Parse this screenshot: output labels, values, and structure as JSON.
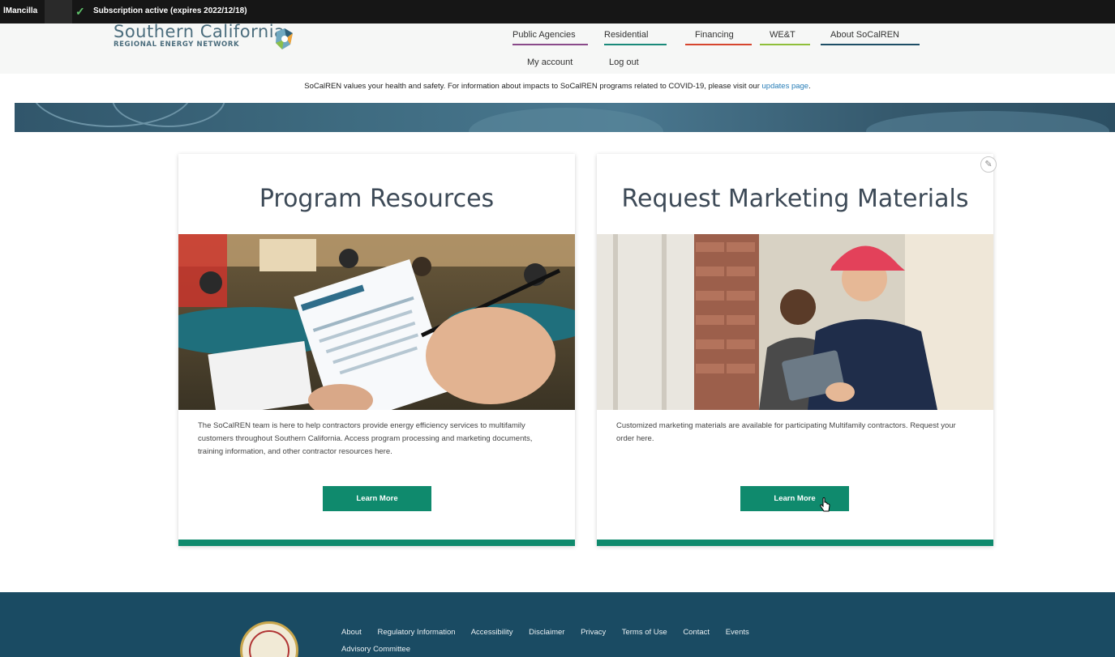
{
  "admin_bar": {
    "user": "lMancilla",
    "status": "Subscription active (expires 2022/12/18)",
    "check_color": "#5fc36a"
  },
  "header": {
    "logo_line1": "Southern California",
    "logo_line2": "REGIONAL ENERGY NETWORK",
    "nav": [
      {
        "label": "Public Agencies",
        "color": "#8a4a8a"
      },
      {
        "label": "Residential",
        "color": "#1a8a7a"
      },
      {
        "label": "Financing",
        "color": "#d6452e"
      },
      {
        "label": "WE&T",
        "color": "#8fbf3a"
      },
      {
        "label": "About SoCalREN",
        "color": "#1e4e66"
      }
    ],
    "sub_nav": [
      "My account",
      "Log out"
    ]
  },
  "notice": {
    "text": "SoCalREN values your health and safety. For information about impacts to SoCalREN programs related to COVID-19, please visit our ",
    "link": "updates page",
    "end": "."
  },
  "cards": [
    {
      "title": "Program Resources",
      "description": "The SoCalREN team is here to help contractors provide energy efficiency services to multifamily customers throughout Southern California. Access program processing and marketing documents, training information, and other contractor resources here.",
      "button": "Learn More"
    },
    {
      "title": "Request Marketing Materials",
      "description": "Customized marketing materials are available for participating Multifamily contractors. Request your order here.",
      "button": "Learn More"
    }
  ],
  "footer": {
    "links": [
      "About",
      "Regulatory Information",
      "Accessibility",
      "Disclaimer",
      "Privacy",
      "Terms of Use",
      "Contact",
      "Events"
    ],
    "links_row2": [
      "Advisory Committee"
    ]
  },
  "colors": {
    "accent_green": "#0f8a6d",
    "footer_bg": "#1a4b63",
    "banner": "#3e6b80"
  }
}
